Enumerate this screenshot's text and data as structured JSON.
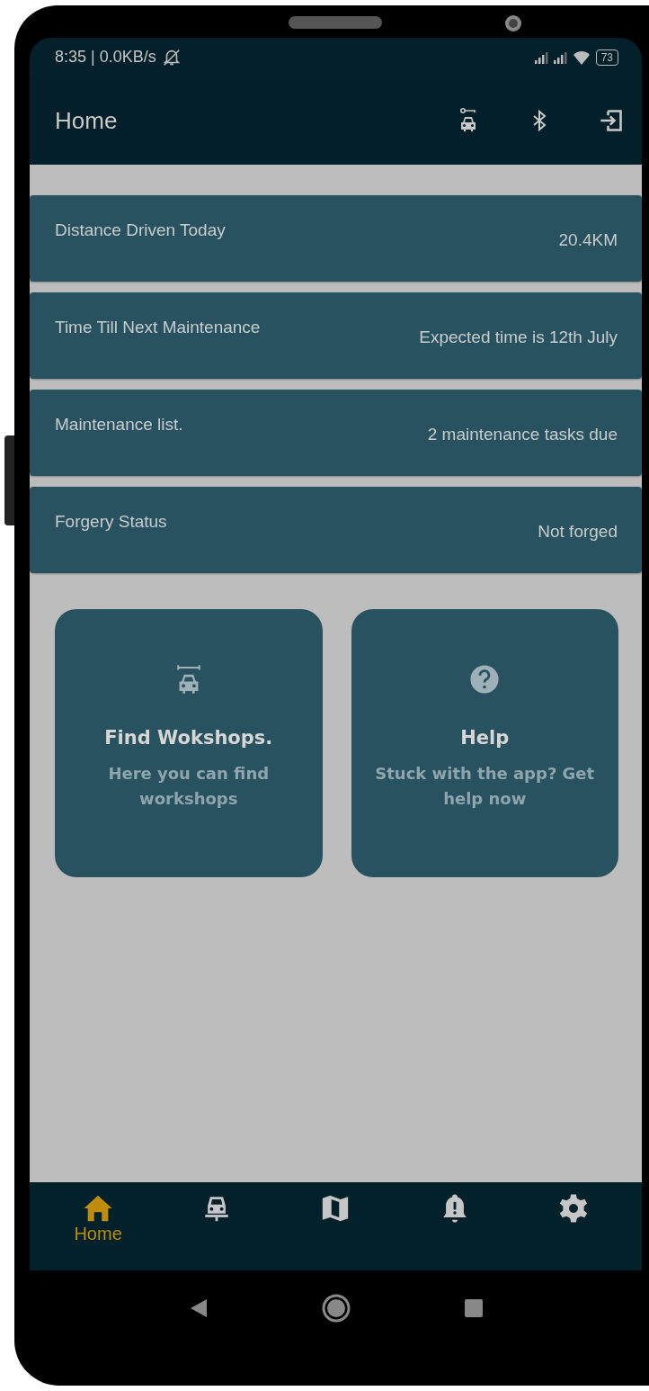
{
  "status_bar": {
    "time": "8:35 | 0.0KB/s",
    "battery": "73"
  },
  "app_bar": {
    "title": "Home"
  },
  "info_cards": [
    {
      "label": "Distance Driven Today",
      "value": "20.4KM"
    },
    {
      "label": "Time Till Next Maintenance",
      "value": "Expected time is 12th July"
    },
    {
      "label": "Maintenance list.",
      "value": "2 maintenance tasks due"
    },
    {
      "label": "Forgery Status",
      "value": "Not forged"
    }
  ],
  "tiles": [
    {
      "kind": "workshop",
      "title": "Find Wokshops.",
      "subtitle": "Here you can find workshops"
    },
    {
      "kind": "help",
      "title": "Help",
      "subtitle": "Stuck with the app? Get help now"
    }
  ],
  "bottom_nav": [
    {
      "kind": "home",
      "label": "Home",
      "selected": true
    },
    {
      "kind": "vehicle",
      "selected": false
    },
    {
      "kind": "map",
      "selected": false
    },
    {
      "kind": "alerts",
      "selected": false
    },
    {
      "kind": "settings",
      "selected": false
    }
  ]
}
